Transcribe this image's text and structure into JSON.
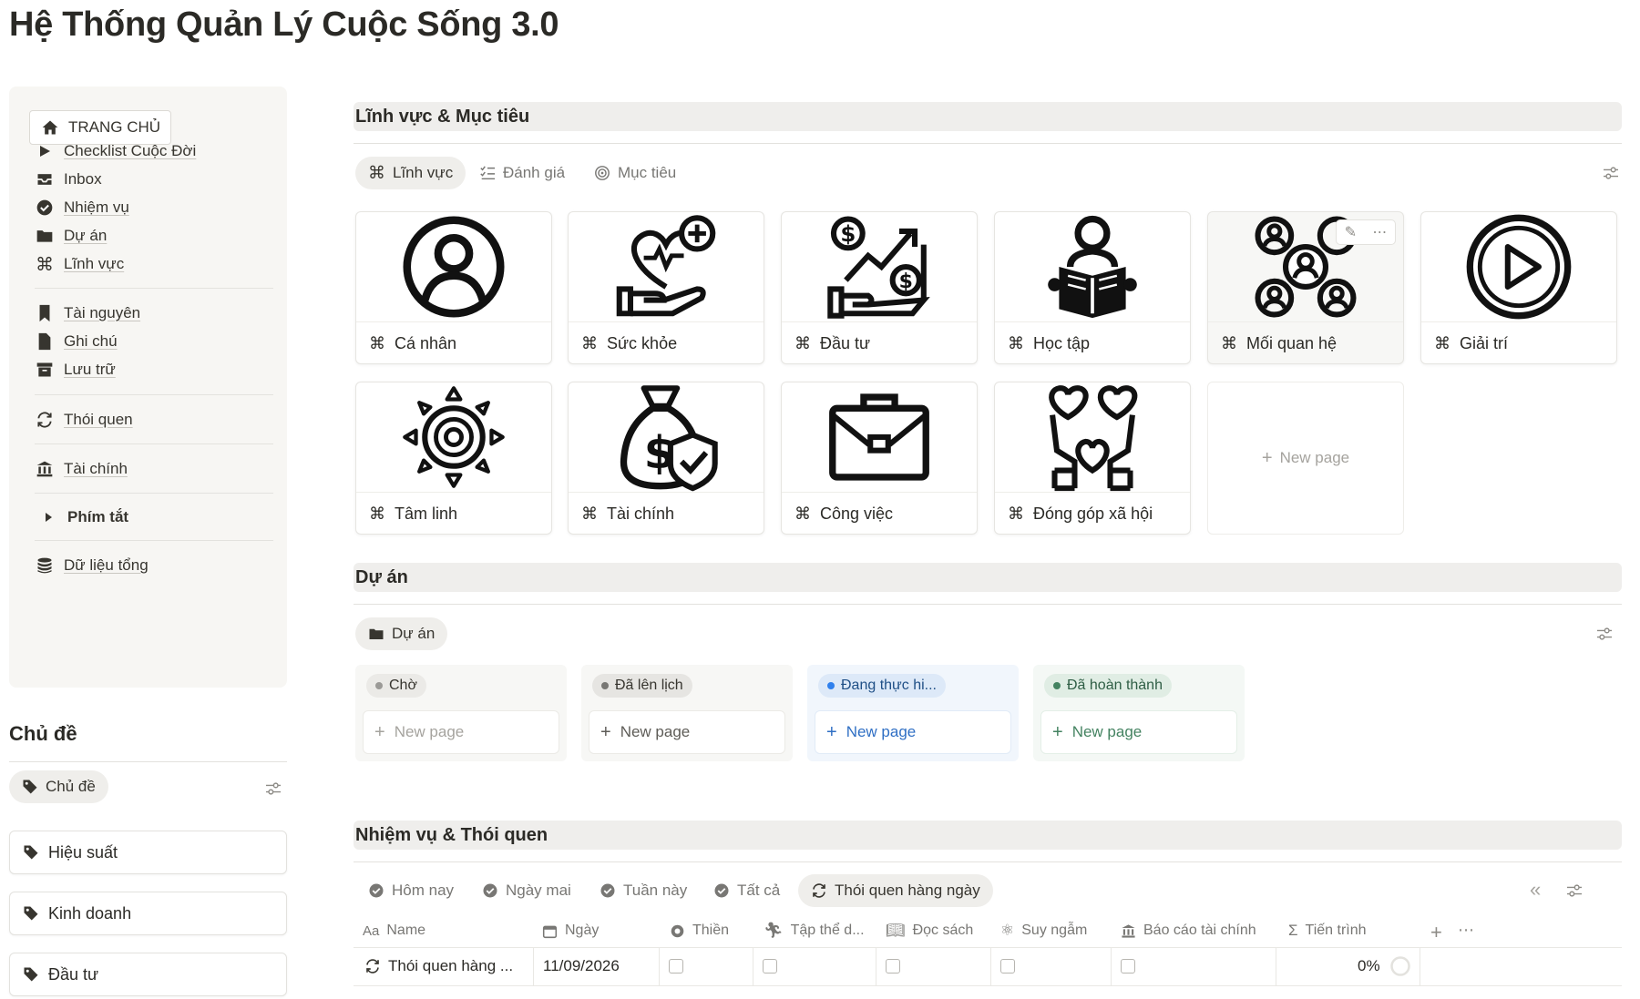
{
  "page": {
    "title": "Hệ Thống Quản Lý Cuộc Sống 3.0"
  },
  "sidebar": {
    "home_label": "TRANG CHỦ",
    "items": [
      {
        "label": "Checklist Cuộc Đời",
        "icon": "play-triangle-icon"
      },
      {
        "label": "Inbox",
        "icon": "inbox-icon"
      },
      {
        "label": "Nhiệm vụ",
        "icon": "check-circle-icon"
      },
      {
        "label": "Dự án",
        "icon": "folder-icon"
      },
      {
        "label": "Lĩnh vực",
        "icon": "command-icon"
      },
      {
        "label": "Tài nguyên",
        "icon": "bookmark-icon"
      },
      {
        "label": "Ghi chú",
        "icon": "document-icon"
      },
      {
        "label": "Lưu trữ",
        "icon": "archive-icon"
      },
      {
        "label": "Thói quen",
        "icon": "repeat-icon"
      },
      {
        "label": "Tài chính",
        "icon": "bank-icon"
      },
      {
        "label": "Phím tắt",
        "icon": "toggle-triangle-icon"
      },
      {
        "label": "Dữ liệu tổng",
        "icon": "database-icon"
      }
    ]
  },
  "topics": {
    "title": "Chủ đề",
    "view_label": "Chủ đề",
    "cards": [
      "Hiệu suất",
      "Kinh doanh",
      "Đầu tư"
    ]
  },
  "areas": {
    "title": "Lĩnh vực & Mục tiêu",
    "tabs": [
      "Lĩnh vực",
      "Đánh giá",
      "Mục tiêu"
    ],
    "cards": [
      {
        "label": "Cá nhân",
        "icon": "person-circle-icon"
      },
      {
        "label": "Sức khỏe",
        "icon": "health-heart-hand-icon"
      },
      {
        "label": "Đầu tư",
        "icon": "investment-chart-icon"
      },
      {
        "label": "Học tập",
        "icon": "reading-person-icon"
      },
      {
        "label": "Mối quan hệ",
        "icon": "network-people-icon"
      },
      {
        "label": "Giải trí",
        "icon": "play-circle-icon"
      },
      {
        "label": "Tâm linh",
        "icon": "sun-spiral-icon"
      },
      {
        "label": "Tài chính",
        "icon": "money-bag-shield-icon"
      },
      {
        "label": "Công việc",
        "icon": "briefcase-icon"
      },
      {
        "label": "Đóng góp xã hội",
        "icon": "hands-hearts-icon"
      }
    ],
    "new_page": "New page"
  },
  "projects": {
    "title": "Dự án",
    "tab": "Dự án",
    "columns": [
      {
        "status": "Chờ",
        "new_page": "New page",
        "color": "#9b9a97"
      },
      {
        "status": "Đã lên lịch",
        "new_page": "New page",
        "color": "#8c8b88"
      },
      {
        "status": "Đang thực hi...",
        "new_page": "New page",
        "color": "#2f80ed"
      },
      {
        "status": "Đã hoàn thành",
        "new_page": "New page",
        "color": "#448361"
      }
    ]
  },
  "tasks": {
    "title": "Nhiệm vụ & Thói quen",
    "tabs": [
      "Hôm nay",
      "Ngày mai",
      "Tuần này",
      "Tất cả",
      "Thói quen hàng ngày"
    ],
    "columns": [
      "Name",
      "Ngày",
      "Thiền",
      "Tập thể d...",
      "Đọc sách",
      "Suy ngẫm",
      "Báo cáo tài chính",
      "Tiến trình"
    ],
    "rows": [
      {
        "name": "Thói quen hàng ...",
        "date": "11/09/2026",
        "progress": "0%"
      }
    ],
    "name_prefix": "Aa",
    "progress_prefix": "Σ"
  }
}
